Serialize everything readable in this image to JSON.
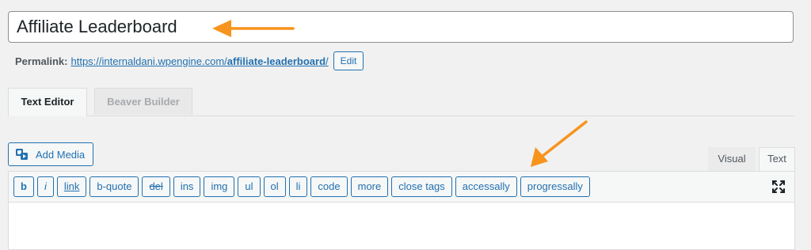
{
  "title_field": {
    "value": "Affiliate Leaderboard"
  },
  "permalink": {
    "label": "Permalink:",
    "url_base": "https://internaldani.wpengine.com/",
    "slug": "affiliate-leaderboard",
    "url_end": "/",
    "edit_label": "Edit"
  },
  "builder_tabs": [
    {
      "label": "Text Editor",
      "active": true
    },
    {
      "label": "Beaver Builder",
      "active": false
    }
  ],
  "media": {
    "add_media_label": "Add Media",
    "icon": "media-icon"
  },
  "editor_modes": [
    {
      "label": "Visual",
      "active": false
    },
    {
      "label": "Text",
      "active": true
    }
  ],
  "quicktags": [
    "b",
    "i",
    "link",
    "b-quote",
    "del",
    "ins",
    "img",
    "ul",
    "ol",
    "li",
    "code",
    "more",
    "close tags",
    "accessally",
    "progressally"
  ],
  "colors": {
    "accent": "#2271b1",
    "arrow": "#f7941d",
    "background": "#f1f1f1"
  },
  "icons": [
    "arrow-annotation-icon",
    "media-icon",
    "fullscreen-icon"
  ]
}
